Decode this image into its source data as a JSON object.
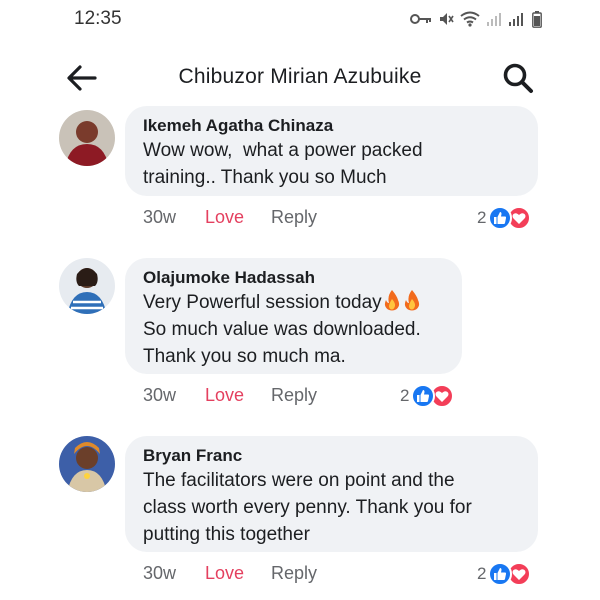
{
  "status_bar": {
    "time": "12:35",
    "icons": [
      "key-icon",
      "mute-icon",
      "wifi-icon",
      "signal-icon",
      "signal-icon",
      "battery-icon"
    ]
  },
  "header": {
    "title": "Chibuzor Mirian Azubuike",
    "back_icon": "arrow-left-icon",
    "search_icon": "search-icon"
  },
  "comments": [
    {
      "author": "Ikemeh Agatha Chinaza",
      "lines": [
        "Wow wow,  what a power packed",
        "training.. Thank you so Much"
      ],
      "time": "30w",
      "love_label": "Love",
      "reply_label": "Reply",
      "reaction_count": "2",
      "reactions": [
        "like-icon",
        "love-icon"
      ]
    },
    {
      "author": "Olajumoke Hadassah",
      "lines": [
        "Very Powerful session today",
        "So much value was downloaded.",
        "Thank you so much ma."
      ],
      "emoji": "fire-icon",
      "time": "30w",
      "love_label": "Love",
      "reply_label": "Reply",
      "reaction_count": "2",
      "reactions": [
        "like-icon",
        "love-icon"
      ]
    },
    {
      "author": "Bryan Franc",
      "lines": [
        "The facilitators were on point and the",
        "class worth every penny. Thank you for",
        "putting this together"
      ],
      "time": "30w",
      "love_label": "Love",
      "reply_label": "Reply",
      "reaction_count": "2",
      "reactions": [
        "like-icon",
        "love-icon"
      ]
    }
  ],
  "colors": {
    "bubble": "#f0f2f5",
    "love_text": "#e4405f",
    "like_blue": "#1877f2",
    "love_red": "#f33e58",
    "meta_gray": "#65676b"
  }
}
